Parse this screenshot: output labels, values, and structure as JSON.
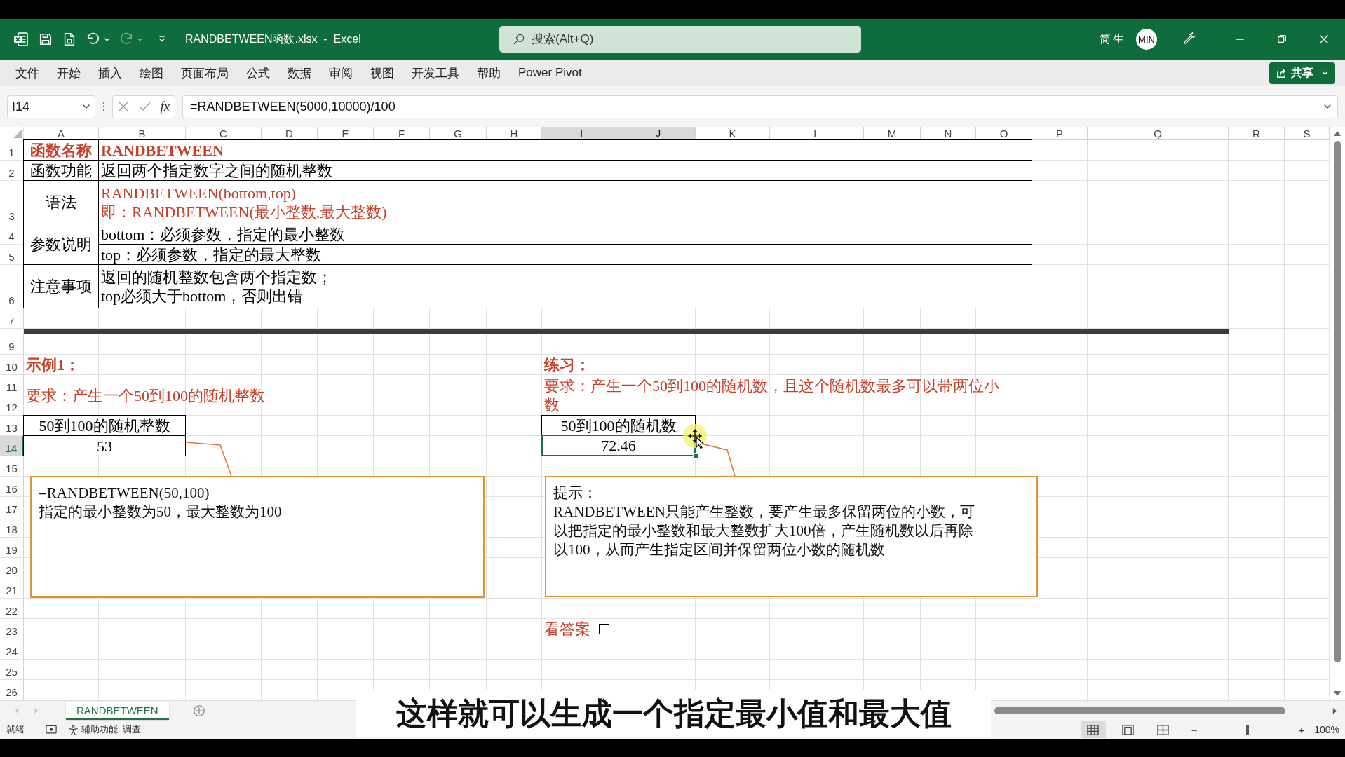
{
  "title_bar": {
    "title": "RANDBETWEEN函数.xlsx  -  Excel",
    "redo": {
      "disabled": true
    },
    "search": {
      "placeholder": "搜索(Alt+Q)"
    },
    "user_name": "简生",
    "avatar": "MIN"
  },
  "ribbon": {
    "tabs": [
      {
        "label": "文件",
        "selected": false
      },
      {
        "label": "开始",
        "selected": false
      },
      {
        "label": "插入",
        "selected": false
      },
      {
        "label": "绘图",
        "selected": false
      },
      {
        "label": "页面布局",
        "selected": false
      },
      {
        "label": "公式",
        "selected": false
      },
      {
        "label": "数据",
        "selected": false
      },
      {
        "label": "审阅",
        "selected": false
      },
      {
        "label": "视图",
        "selected": false
      },
      {
        "label": "开发工具",
        "selected": false
      },
      {
        "label": "帮助",
        "selected": false
      },
      {
        "label": "Power Pivot",
        "selected": false
      }
    ],
    "share_button": "共享"
  },
  "formula_bar": {
    "name_box": "I14",
    "function_button": "fx",
    "formula": "=RANDBETWEEN(5000,10000)/100"
  },
  "sheet": {
    "columns": [
      {
        "label": "A",
        "selected": false
      },
      {
        "label": "B",
        "selected": false
      },
      {
        "label": "C",
        "selected": false
      },
      {
        "label": "D",
        "selected": false
      },
      {
        "label": "E",
        "selected": false
      },
      {
        "label": "F",
        "selected": false
      },
      {
        "label": "G",
        "selected": false
      },
      {
        "label": "H",
        "selected": false
      },
      {
        "label": "I",
        "selected": true
      },
      {
        "label": "J",
        "selected": true
      },
      {
        "label": "K",
        "selected": false
      },
      {
        "label": "L",
        "selected": false
      },
      {
        "label": "M",
        "selected": false
      },
      {
        "label": "N",
        "selected": false
      },
      {
        "label": "O",
        "selected": false
      },
      {
        "label": "P",
        "selected": false
      },
      {
        "label": "Q",
        "selected": false
      },
      {
        "label": "R",
        "selected": false
      },
      {
        "label": "S",
        "selected": false
      }
    ],
    "rows": [
      {
        "label": "1",
        "kind": "normal",
        "selected": false
      },
      {
        "label": "2",
        "kind": "normal",
        "selected": false
      },
      {
        "label": "3",
        "kind": "tall",
        "selected": false
      },
      {
        "label": "4",
        "kind": "normal",
        "selected": false
      },
      {
        "label": "5",
        "kind": "normal",
        "selected": false
      },
      {
        "label": "6",
        "kind": "tall",
        "selected": false
      },
      {
        "label": "7",
        "kind": "normal",
        "selected": false
      },
      {
        "kind": "divider"
      },
      {
        "label": "9",
        "kind": "normal",
        "selected": false
      },
      {
        "label": "10",
        "kind": "normal",
        "selected": false
      },
      {
        "label": "11",
        "kind": "normal",
        "selected": false
      },
      {
        "label": "12",
        "kind": "normal",
        "selected": false
      },
      {
        "label": "13",
        "kind": "normal",
        "selected": false
      },
      {
        "label": "14",
        "kind": "normal",
        "selected": true
      },
      {
        "label": "15",
        "kind": "normal",
        "selected": false
      },
      {
        "label": "16",
        "kind": "normal",
        "selected": false
      },
      {
        "label": "17",
        "kind": "normal",
        "selected": false
      },
      {
        "label": "18",
        "kind": "normal",
        "selected": false
      },
      {
        "label": "19",
        "kind": "normal",
        "selected": false
      },
      {
        "label": "20",
        "kind": "normal",
        "selected": false
      },
      {
        "label": "21",
        "kind": "normal",
        "selected": false
      },
      {
        "label": "22",
        "kind": "normal",
        "selected": false
      },
      {
        "label": "23",
        "kind": "normal",
        "selected": false
      },
      {
        "label": "24",
        "kind": "normal",
        "selected": false
      },
      {
        "label": "25",
        "kind": "normal",
        "selected": false
      },
      {
        "label": "26",
        "kind": "normal",
        "selected": false
      }
    ],
    "cells": [
      {
        "kind": "title",
        "text": "函数名称",
        "selected": false
      },
      {
        "kind": "title",
        "text": "RANDBETWEEN",
        "selected": false
      },
      {
        "kind": "value",
        "text": "函数功能",
        "selected": false
      },
      {
        "kind": "value",
        "text": "返回两个指定数字之间的随机整数",
        "selected": false
      },
      {
        "kind": "value",
        "text": "语法",
        "selected": false
      },
      {
        "kind": "note",
        "lines": [
          "RANDBETWEEN(bottom,top)",
          "即：RANDBETWEEN(最小整数,最大整数)"
        ],
        "selected": false
      },
      {
        "kind": "value",
        "text": "参数说明",
        "selected": false
      },
      {
        "kind": "value",
        "text": "bottom：必须参数，指定的最小整数",
        "selected": false
      },
      {
        "kind": "value",
        "text": "top：必须参数，指定的最大整数",
        "selected": false
      },
      {
        "kind": "value",
        "text": "注意事项",
        "selected": false
      },
      {
        "kind": "value",
        "lines": [
          "返回的随机整数包含两个指定数；",
          "top必须大于bottom，否则出错"
        ],
        "selected": false
      },
      {
        "kind": "rule"
      },
      {
        "kind": "title",
        "text": "示例1：",
        "selected": false
      },
      {
        "kind": "note",
        "text": "要求：产生一个50到100的随机整数",
        "selected": false
      },
      {
        "kind": "value",
        "text": "50到100的随机整数",
        "selected": false
      },
      {
        "kind": "value",
        "text": "53",
        "selected": false
      },
      {
        "kind": "title",
        "text": "练习：",
        "selected": false
      },
      {
        "kind": "note",
        "lines": [
          "要求：产生一个50到100的随机数，且这个随机数最多可以带两位小",
          "数"
        ],
        "selected": false
      },
      {
        "kind": "value",
        "text": "50到100的随机数",
        "selected": false
      },
      {
        "kind": "value",
        "text": "72.46",
        "selected": true
      },
      {
        "kind": "checkbox",
        "text": "看答案",
        "checked": false
      }
    ],
    "callouts": [
      {
        "paragraphs": [
          [
            "=RANDBETWEEN(50,100)"
          ],
          [
            "指定的最小整数为50，最大整数为100"
          ]
        ]
      },
      {
        "paragraphs": [
          [
            "提示："
          ],
          [
            "RANDBETWEEN只能产生整数，要产生最多保留两位的小数，可",
            "以把指定的最小整数和最大整数扩大100倍，产生随机数以后再除",
            "以100，从而产生指定区间并保留两位小数的随机数"
          ]
        ]
      }
    ]
  },
  "sheet_tabs": [
    {
      "label": "RANDBETWEEN",
      "selected": true
    }
  ],
  "status_bar": {
    "status": "就绪",
    "accessibility": "辅助功能: 调查",
    "views": [
      {
        "kind": "normal",
        "selected": true
      },
      {
        "kind": "page_layout",
        "selected": false
      },
      {
        "kind": "page_break",
        "selected": false
      }
    ],
    "zoom": {
      "minus": "−",
      "plus": "+",
      "level": 0.5,
      "percent": "100%"
    }
  },
  "caption": "这样就可以生成一个指定最小值和最大值"
}
